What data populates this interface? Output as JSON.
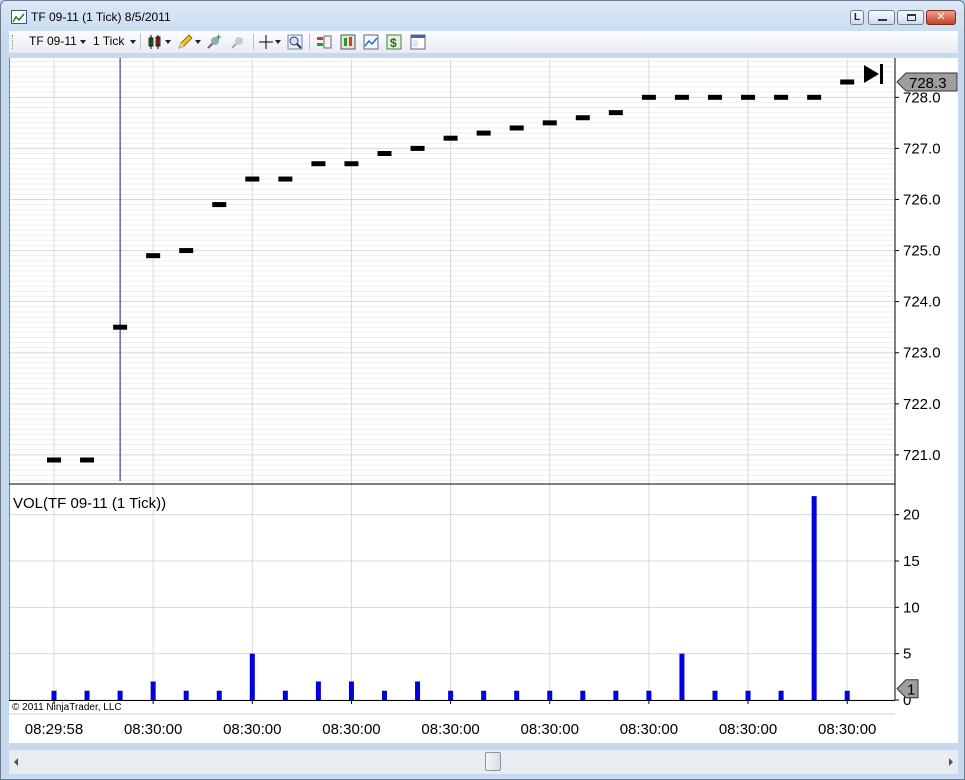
{
  "window": {
    "title": "TF 09-11 (1 Tick)  8/5/2011",
    "btn_l": "L",
    "btn_close": "✕"
  },
  "toolbar": {
    "instrument": "TF 09-11",
    "interval": "1 Tick"
  },
  "copyright": "© 2011 NinjaTrader, LLC",
  "colors": {
    "price_bar": "#000000",
    "volume_bar": "#0000dd",
    "crosshair": "#1a1a80",
    "grid_major": "#d8d8d8",
    "grid_minor": "#eeeeee"
  },
  "chart_data": [
    {
      "type": "scatter",
      "panel": "price",
      "y": [
        720.9,
        720.9,
        723.5,
        724.9,
        725.0,
        725.9,
        726.4,
        726.4,
        726.7,
        726.7,
        726.9,
        727.0,
        727.2,
        727.3,
        727.4,
        727.5,
        727.6,
        727.7,
        728.0,
        728.0,
        728.0,
        728.0,
        728.0,
        728.0,
        728.3
      ],
      "ylim": [
        720.45,
        728.75
      ],
      "yticks": [
        "721.0",
        "722.0",
        "723.0",
        "724.0",
        "725.0",
        "726.0",
        "727.0",
        "728.0"
      ],
      "last_price_label": "728.3",
      "grid": true
    },
    {
      "type": "bar",
      "panel": "volume",
      "title": "VOL(TF 09-11 (1 Tick))",
      "values": [
        1,
        1,
        1,
        2,
        1,
        1,
        5,
        1,
        2,
        2,
        1,
        2,
        1,
        1,
        1,
        1,
        1,
        1,
        1,
        5,
        1,
        1,
        1,
        22,
        1
      ],
      "ylim": [
        0,
        23.2
      ],
      "yticks": [
        "0",
        "5",
        "10",
        "15",
        "20"
      ],
      "last_volume_label": "1",
      "xticks": [
        "08:29:58",
        "08:30:00",
        "08:30:00",
        "08:30:00",
        "08:30:00",
        "08:30:00",
        "08:30:00",
        "08:30:00",
        "08:30:00"
      ],
      "grid": true
    }
  ]
}
